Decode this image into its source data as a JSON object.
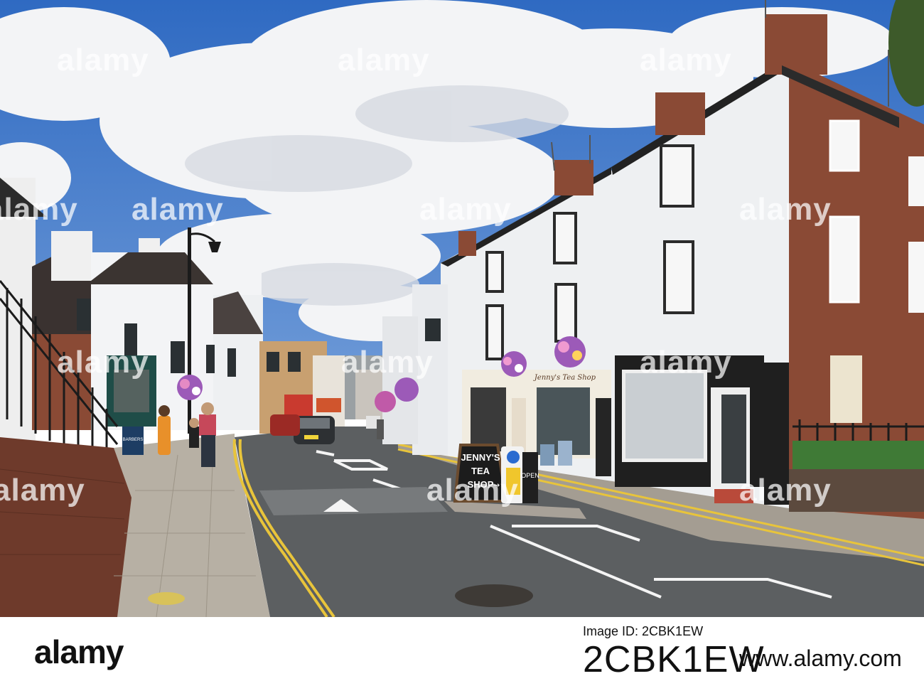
{
  "watermark": {
    "text": "alamy"
  },
  "signs": {
    "aboard_line1": "JENNY'S",
    "aboard_line2": "TEA",
    "aboard_line3": "SHOP",
    "aboard_arrow": "→",
    "shop_fascia": "Jenny's Tea Shop",
    "barbers": "BARBERS",
    "open": "OPEN"
  },
  "footer": {
    "logo": "alamy",
    "image_id_label": "Image ID: 2CBK1EW",
    "image_id": "2CBK1EW",
    "site": "www.alamy.com"
  },
  "colors": {
    "sky": "#3b76c9",
    "cloud": "#f2f3f5",
    "road": "#5a5d5f",
    "pavement": "#b9b2a6",
    "brick": "#8a4a35",
    "white_render": "#eef0f2",
    "yellow_line": "#e8c43b"
  }
}
